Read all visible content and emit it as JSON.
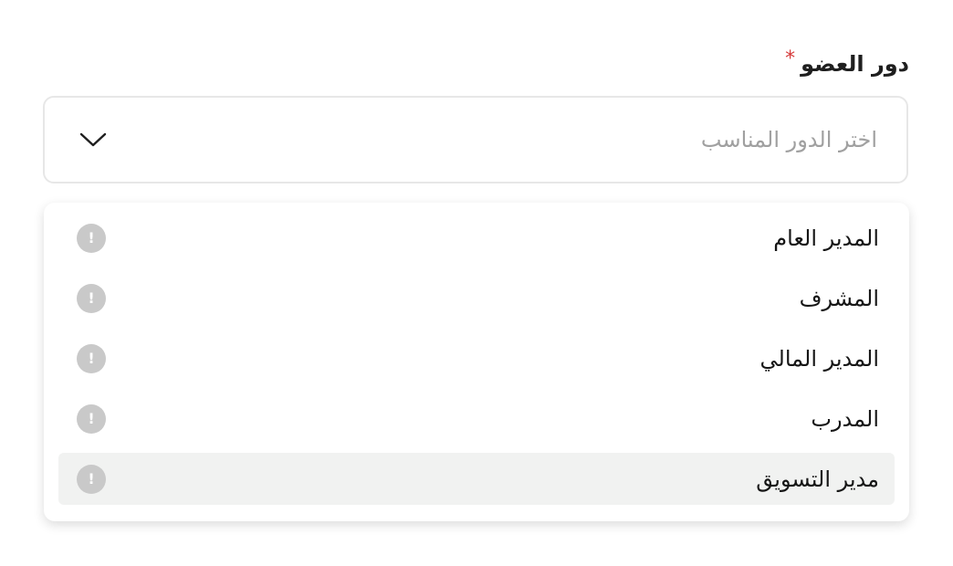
{
  "field": {
    "label": "دور العضو",
    "required_marker": "*",
    "placeholder": "اختر الدور المناسب",
    "chevron_icon": "chevron-down-icon"
  },
  "dropdown": {
    "items": [
      {
        "label": "المدير العام",
        "icon": "info-icon"
      },
      {
        "label": "المشرف",
        "icon": "info-icon"
      },
      {
        "label": "المدير المالي",
        "icon": "info-icon"
      },
      {
        "label": "المدرب",
        "icon": "info-icon"
      },
      {
        "label": "مدير التسويق",
        "icon": "info-icon"
      }
    ],
    "highlighted_index": 4
  },
  "colors": {
    "required_star": "#d63b3b",
    "highlight_background": "#f1f2f1",
    "info_icon": "#c9c9c9",
    "placeholder_text": "#a0a0a0"
  }
}
